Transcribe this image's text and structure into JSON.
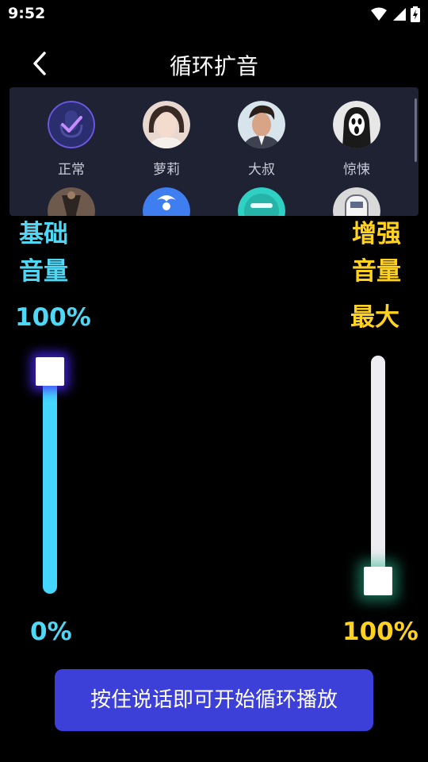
{
  "status_bar": {
    "time": "9:52",
    "icons": [
      "wifi-icon",
      "cell-signal-icon",
      "battery-charging-icon"
    ]
  },
  "header": {
    "back_icon": "chevron-left-icon",
    "title": "循环扩音"
  },
  "voices": {
    "items": [
      {
        "label": "正常",
        "selected": true
      },
      {
        "label": "萝莉",
        "selected": false
      },
      {
        "label": "大叔",
        "selected": false
      },
      {
        "label": "惊悚",
        "selected": false
      },
      {
        "label": "",
        "selected": false
      },
      {
        "label": "",
        "selected": false
      },
      {
        "label": "",
        "selected": false
      },
      {
        "label": "",
        "selected": false
      }
    ]
  },
  "base_volume": {
    "title_line1": "基础",
    "title_line2": "音量",
    "value": "100%",
    "min_label": "0%",
    "level": 1.0,
    "color": "#45d6ff"
  },
  "boost_volume": {
    "title_line1": "增强",
    "title_line2": "音量",
    "value": "最大",
    "min_label": "100%",
    "level": 0.0,
    "color": "#ffd21f"
  },
  "action": {
    "play_label": "按住说话即可开始循环播放"
  },
  "colors": {
    "accent_cyan": "#4fd8f5",
    "accent_yellow": "#ffd21f",
    "button": "#3c3fd8",
    "panel": "#1e2233"
  }
}
